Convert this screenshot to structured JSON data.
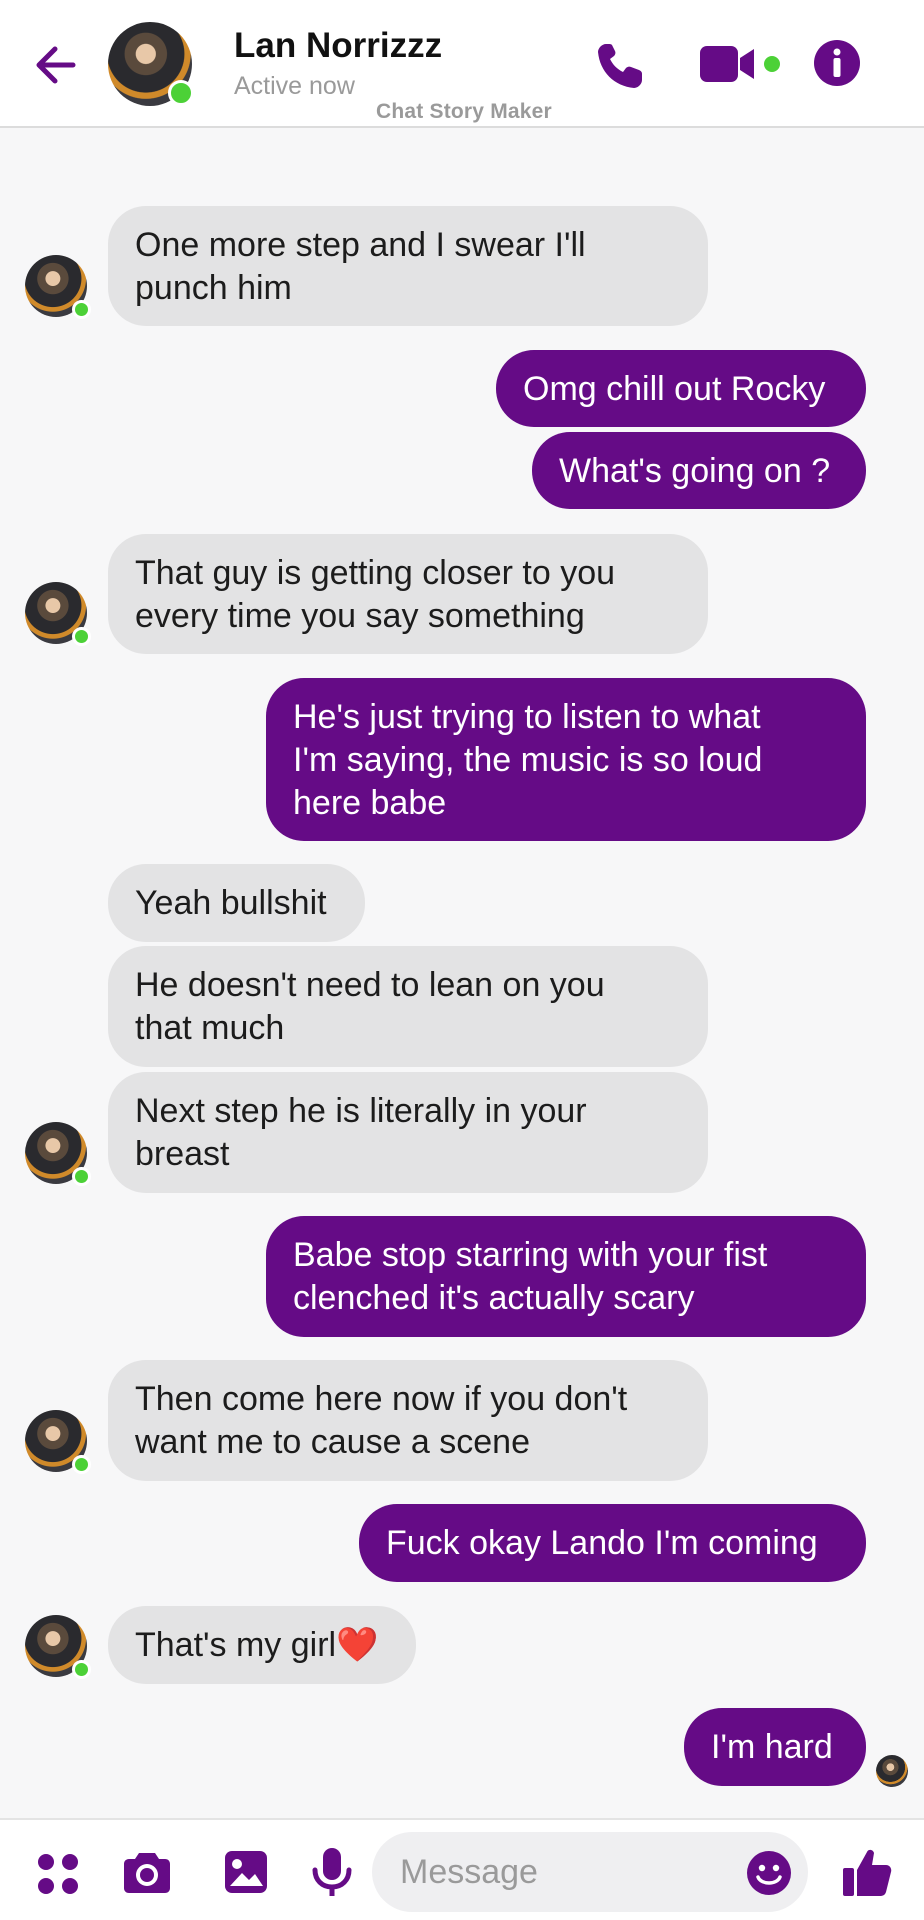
{
  "header": {
    "contact_name": "Lan Norrizzz",
    "status": "Active now",
    "watermark": "Chat Story Maker"
  },
  "colors": {
    "accent": "#650b86",
    "incoming_bubble": "#e3e3e4",
    "online": "#4cd137"
  },
  "icons": {
    "back": "arrow-left-icon",
    "call": "phone-icon",
    "video": "video-camera-icon",
    "info": "info-icon",
    "apps": "four-dots-icon",
    "camera": "camera-icon",
    "gallery": "image-icon",
    "voice": "microphone-icon",
    "emoji": "smiley-icon",
    "like": "thumbs-up-icon"
  },
  "messages": [
    {
      "from": "them",
      "lines": [
        "One more step and I swear I'll",
        "punch him"
      ]
    },
    {
      "from": "me",
      "lines": [
        "Omg chill out Rocky"
      ]
    },
    {
      "from": "me",
      "lines": [
        "What's going on ?"
      ]
    },
    {
      "from": "them",
      "lines": [
        "That guy is getting closer to you",
        "every time you say something"
      ]
    },
    {
      "from": "me",
      "lines": [
        "He's just trying to listen to what",
        "I'm saying, the music is so loud",
        "here babe"
      ]
    },
    {
      "from": "them",
      "lines": [
        "Yeah bullshit"
      ]
    },
    {
      "from": "them",
      "lines": [
        "He doesn't need to lean on you",
        "that much"
      ]
    },
    {
      "from": "them",
      "lines": [
        "Next step he is literally in your",
        "breast"
      ]
    },
    {
      "from": "me",
      "lines": [
        "Babe stop starring with your fist",
        "clenched it's actually scary"
      ]
    },
    {
      "from": "them",
      "lines": [
        "Then come here now if you don't",
        "want me to cause a scene"
      ]
    },
    {
      "from": "me",
      "lines": [
        "Fuck okay Lando I'm coming"
      ]
    },
    {
      "from": "them",
      "lines": [
        "That's my girl❤️"
      ]
    },
    {
      "from": "me",
      "lines": [
        "I'm hard"
      ]
    }
  ],
  "composer": {
    "placeholder": "Message"
  }
}
